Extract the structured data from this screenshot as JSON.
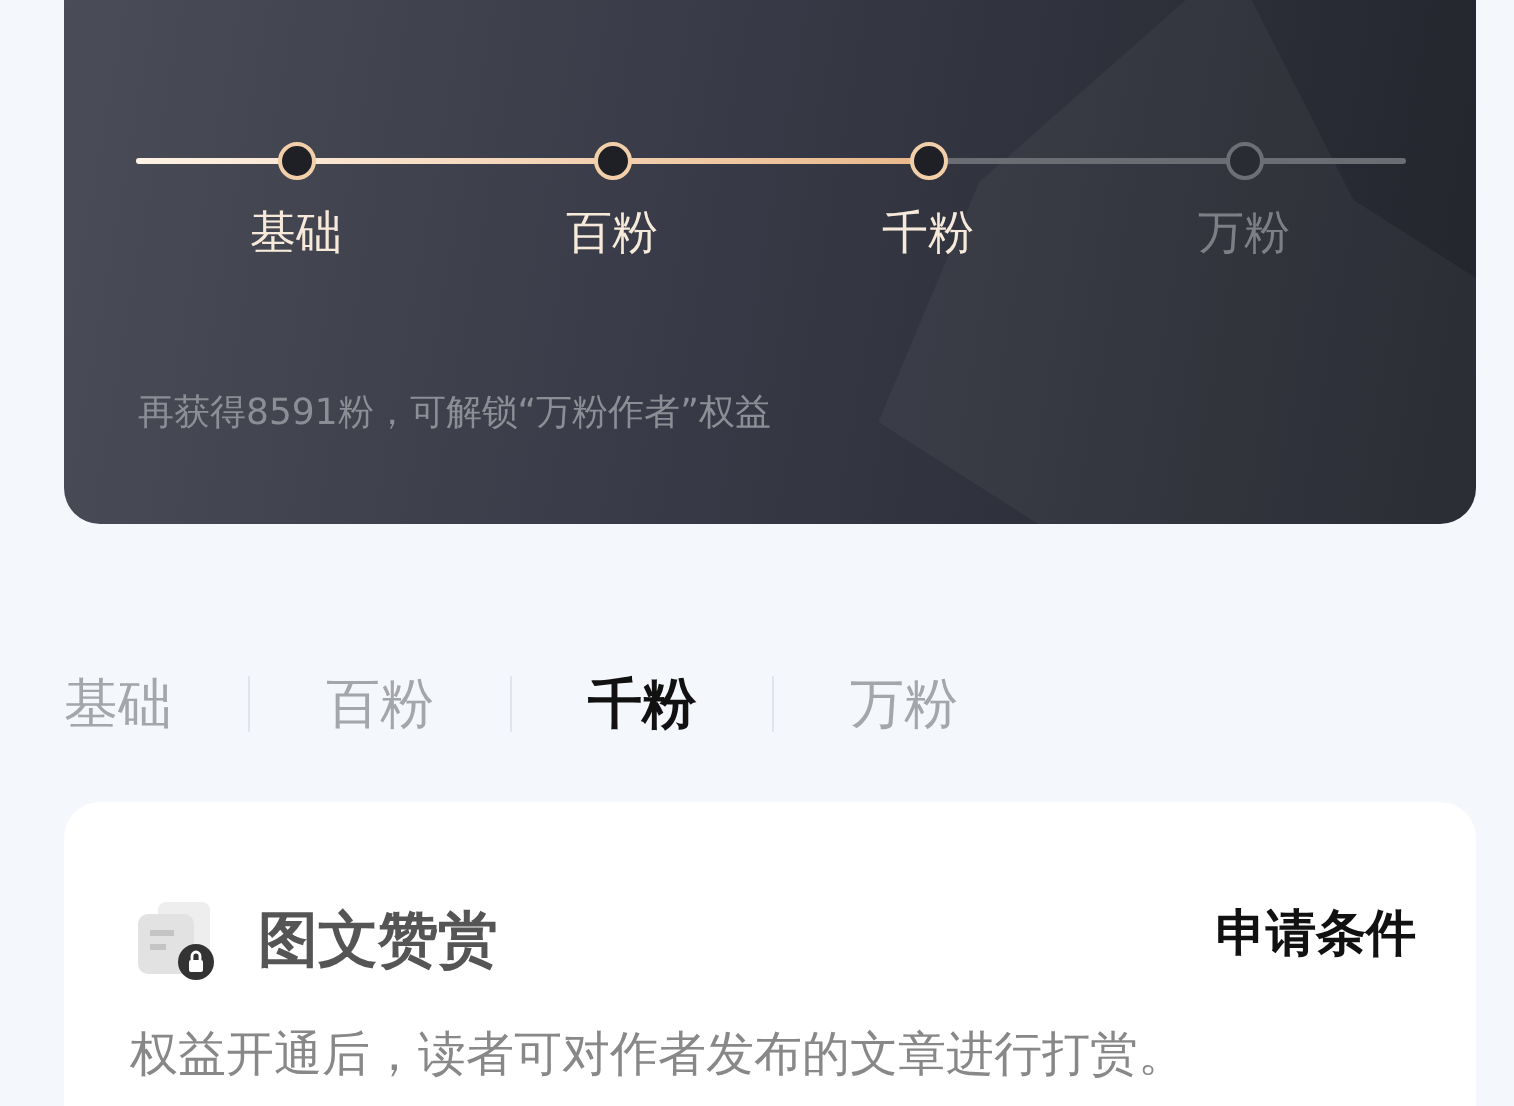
{
  "progress_card": {
    "level": 0.62,
    "milestones": [
      {
        "label": "基础",
        "reached": true
      },
      {
        "label": "百粉",
        "reached": true
      },
      {
        "label": "千粉",
        "reached": true
      },
      {
        "label": "万粉",
        "reached": false
      }
    ],
    "hint": "再获得8591粉，可解锁“万粉作者”权益"
  },
  "tabs": [
    {
      "label": "基础",
      "selected": false
    },
    {
      "label": "百粉",
      "selected": false
    },
    {
      "label": "千粉",
      "selected": true
    },
    {
      "label": "万粉",
      "selected": false
    }
  ],
  "benefit_card": {
    "title": "图文赞赏",
    "locked": true,
    "action": "申请条件",
    "description": "权益开通后，读者可对作者发布的文章进行打赏。"
  }
}
